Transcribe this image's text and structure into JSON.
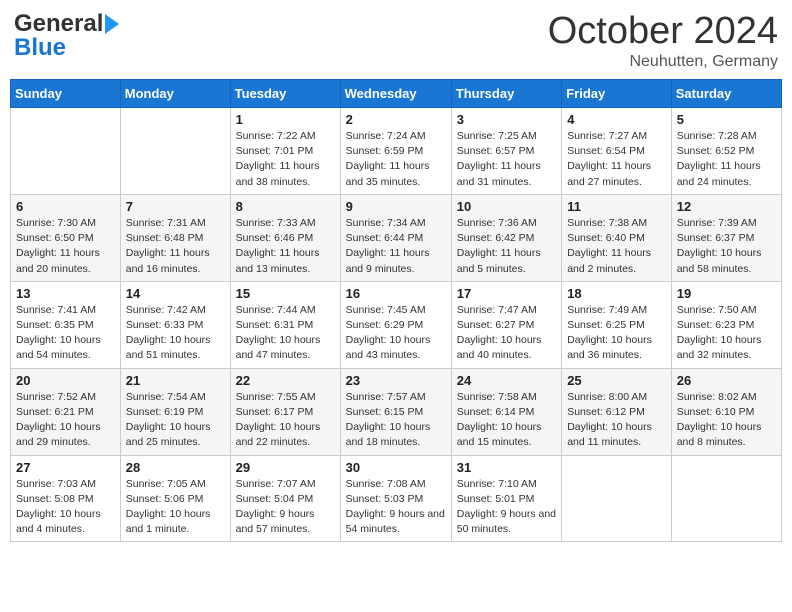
{
  "header": {
    "logo_line1": "General",
    "logo_line2": "Blue",
    "month": "October 2024",
    "location": "Neuhutten, Germany"
  },
  "weekdays": [
    "Sunday",
    "Monday",
    "Tuesday",
    "Wednesday",
    "Thursday",
    "Friday",
    "Saturday"
  ],
  "weeks": [
    [
      {
        "day": "",
        "info": ""
      },
      {
        "day": "",
        "info": ""
      },
      {
        "day": "1",
        "info": "Sunrise: 7:22 AM\nSunset: 7:01 PM\nDaylight: 11 hours and 38 minutes."
      },
      {
        "day": "2",
        "info": "Sunrise: 7:24 AM\nSunset: 6:59 PM\nDaylight: 11 hours and 35 minutes."
      },
      {
        "day": "3",
        "info": "Sunrise: 7:25 AM\nSunset: 6:57 PM\nDaylight: 11 hours and 31 minutes."
      },
      {
        "day": "4",
        "info": "Sunrise: 7:27 AM\nSunset: 6:54 PM\nDaylight: 11 hours and 27 minutes."
      },
      {
        "day": "5",
        "info": "Sunrise: 7:28 AM\nSunset: 6:52 PM\nDaylight: 11 hours and 24 minutes."
      }
    ],
    [
      {
        "day": "6",
        "info": "Sunrise: 7:30 AM\nSunset: 6:50 PM\nDaylight: 11 hours and 20 minutes."
      },
      {
        "day": "7",
        "info": "Sunrise: 7:31 AM\nSunset: 6:48 PM\nDaylight: 11 hours and 16 minutes."
      },
      {
        "day": "8",
        "info": "Sunrise: 7:33 AM\nSunset: 6:46 PM\nDaylight: 11 hours and 13 minutes."
      },
      {
        "day": "9",
        "info": "Sunrise: 7:34 AM\nSunset: 6:44 PM\nDaylight: 11 hours and 9 minutes."
      },
      {
        "day": "10",
        "info": "Sunrise: 7:36 AM\nSunset: 6:42 PM\nDaylight: 11 hours and 5 minutes."
      },
      {
        "day": "11",
        "info": "Sunrise: 7:38 AM\nSunset: 6:40 PM\nDaylight: 11 hours and 2 minutes."
      },
      {
        "day": "12",
        "info": "Sunrise: 7:39 AM\nSunset: 6:37 PM\nDaylight: 10 hours and 58 minutes."
      }
    ],
    [
      {
        "day": "13",
        "info": "Sunrise: 7:41 AM\nSunset: 6:35 PM\nDaylight: 10 hours and 54 minutes."
      },
      {
        "day": "14",
        "info": "Sunrise: 7:42 AM\nSunset: 6:33 PM\nDaylight: 10 hours and 51 minutes."
      },
      {
        "day": "15",
        "info": "Sunrise: 7:44 AM\nSunset: 6:31 PM\nDaylight: 10 hours and 47 minutes."
      },
      {
        "day": "16",
        "info": "Sunrise: 7:45 AM\nSunset: 6:29 PM\nDaylight: 10 hours and 43 minutes."
      },
      {
        "day": "17",
        "info": "Sunrise: 7:47 AM\nSunset: 6:27 PM\nDaylight: 10 hours and 40 minutes."
      },
      {
        "day": "18",
        "info": "Sunrise: 7:49 AM\nSunset: 6:25 PM\nDaylight: 10 hours and 36 minutes."
      },
      {
        "day": "19",
        "info": "Sunrise: 7:50 AM\nSunset: 6:23 PM\nDaylight: 10 hours and 32 minutes."
      }
    ],
    [
      {
        "day": "20",
        "info": "Sunrise: 7:52 AM\nSunset: 6:21 PM\nDaylight: 10 hours and 29 minutes."
      },
      {
        "day": "21",
        "info": "Sunrise: 7:54 AM\nSunset: 6:19 PM\nDaylight: 10 hours and 25 minutes."
      },
      {
        "day": "22",
        "info": "Sunrise: 7:55 AM\nSunset: 6:17 PM\nDaylight: 10 hours and 22 minutes."
      },
      {
        "day": "23",
        "info": "Sunrise: 7:57 AM\nSunset: 6:15 PM\nDaylight: 10 hours and 18 minutes."
      },
      {
        "day": "24",
        "info": "Sunrise: 7:58 AM\nSunset: 6:14 PM\nDaylight: 10 hours and 15 minutes."
      },
      {
        "day": "25",
        "info": "Sunrise: 8:00 AM\nSunset: 6:12 PM\nDaylight: 10 hours and 11 minutes."
      },
      {
        "day": "26",
        "info": "Sunrise: 8:02 AM\nSunset: 6:10 PM\nDaylight: 10 hours and 8 minutes."
      }
    ],
    [
      {
        "day": "27",
        "info": "Sunrise: 7:03 AM\nSunset: 5:08 PM\nDaylight: 10 hours and 4 minutes."
      },
      {
        "day": "28",
        "info": "Sunrise: 7:05 AM\nSunset: 5:06 PM\nDaylight: 10 hours and 1 minute."
      },
      {
        "day": "29",
        "info": "Sunrise: 7:07 AM\nSunset: 5:04 PM\nDaylight: 9 hours and 57 minutes."
      },
      {
        "day": "30",
        "info": "Sunrise: 7:08 AM\nSunset: 5:03 PM\nDaylight: 9 hours and 54 minutes."
      },
      {
        "day": "31",
        "info": "Sunrise: 7:10 AM\nSunset: 5:01 PM\nDaylight: 9 hours and 50 minutes."
      },
      {
        "day": "",
        "info": ""
      },
      {
        "day": "",
        "info": ""
      }
    ]
  ]
}
